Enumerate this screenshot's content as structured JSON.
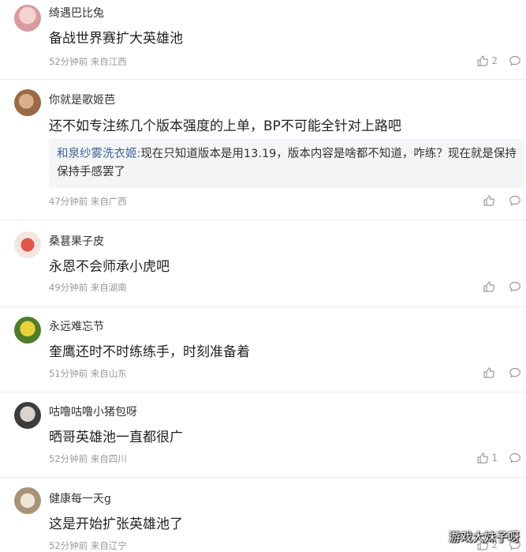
{
  "comments": [
    {
      "username": "绮遇巴比兔",
      "text": "备战世界赛扩大英雄池",
      "time": "52分钟前",
      "location": "来自江西",
      "likes": "2",
      "avatar_color": "#e7b7b9"
    },
    {
      "username": "你就是歌姬芭",
      "text": "还不如专注练几个版本强度的上单，BP不可能全针对上路吧",
      "reply_name": "和泉纱雾洗衣姬:",
      "reply_text": "现在只知道版本是用13.19，版本内容是啥都不知道，咋练？现在就是保持保持手感罢了",
      "time": "47分钟前",
      "location": "来自广西",
      "likes": "",
      "avatar_color": "#b3815a"
    },
    {
      "username": "桑葚果子皮",
      "text": "永恩不会师承小虎吧",
      "time": "49分钟前",
      "location": "来自湖南",
      "likes": "",
      "avatar_color": "#c8463b"
    },
    {
      "username": "永远难忘节",
      "text": "奎鹰还时不时练练手，时刻准备着",
      "time": "51分钟前",
      "location": "来自山东",
      "likes": "",
      "avatar_color": "#5f8d36"
    },
    {
      "username": "咕噜咕噜小猪包呀",
      "text": "晒哥英雄池一直都很广",
      "time": "52分钟前",
      "location": "来自四川",
      "likes": "1",
      "avatar_color": "#555555"
    },
    {
      "username": "健康每一天g",
      "text": "这是开始扩张英雄池了",
      "time": "52分钟前",
      "location": "来自辽宁",
      "likes": "2",
      "avatar_color": "#b9a58a"
    }
  ],
  "watermark": "游戏大妹子呀"
}
